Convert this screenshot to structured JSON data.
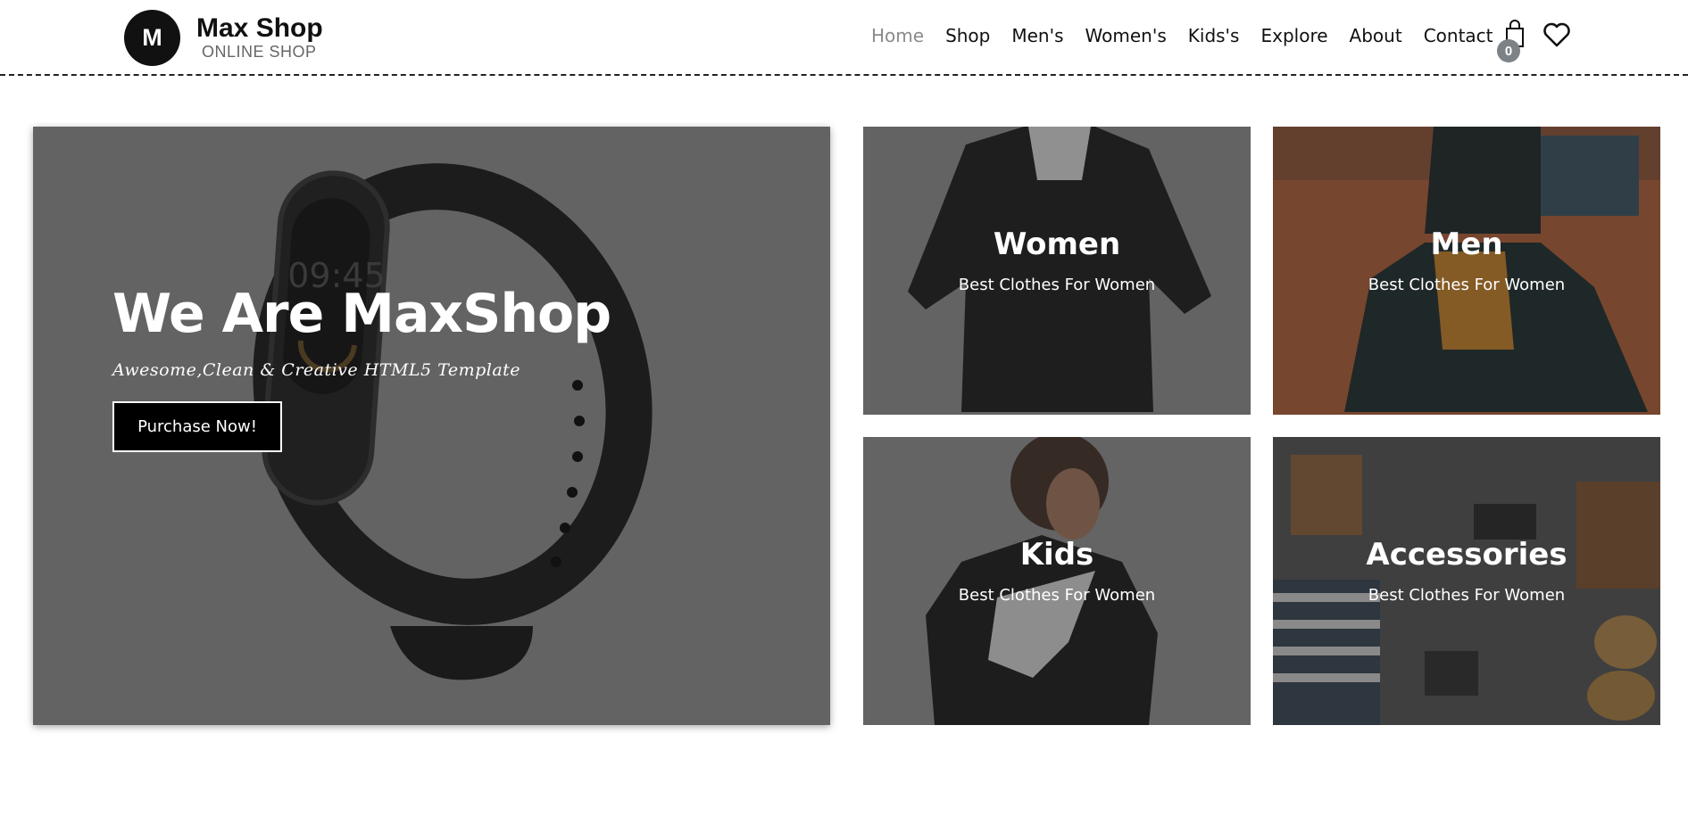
{
  "brand": {
    "logo_letter": "M",
    "name": "Max Shop",
    "tagline": "ONLINE SHOP"
  },
  "nav": {
    "items": [
      {
        "label": "Home",
        "active": true
      },
      {
        "label": "Shop",
        "active": false
      },
      {
        "label": "Men's",
        "active": false
      },
      {
        "label": "Women's",
        "active": false
      },
      {
        "label": "Kids's",
        "active": false
      },
      {
        "label": "Explore",
        "active": false
      },
      {
        "label": "About",
        "active": false
      },
      {
        "label": "Contact",
        "active": false
      }
    ],
    "cart_icon": "shopping-bag-icon",
    "cart_count": "0",
    "wishlist_icon": "heart-icon"
  },
  "hero": {
    "title": "We Are MaxShop",
    "subtitle": "Awesome,Clean & Creative HTML5 Template",
    "button_label": "Purchase Now!",
    "image": "fitness-band-image",
    "band_time": "09:45"
  },
  "categories": [
    {
      "title": "Women",
      "subtitle": "Best Clothes For Women",
      "image": "black-shirt-image"
    },
    {
      "title": "Men",
      "subtitle": "Best Clothes For Women",
      "image": "man-in-beanie-image"
    },
    {
      "title": "Kids",
      "subtitle": "Best Clothes For Women",
      "image": "kid-in-hoodie-image"
    },
    {
      "title": "Accessories",
      "subtitle": "Best Clothes For Women",
      "image": "flat-lay-accessories-image"
    }
  ],
  "colors": {
    "accent_text": "#111111",
    "nav_active": "#8a8a8a",
    "badge": "#7d8287",
    "hero_bg": "#636363"
  }
}
